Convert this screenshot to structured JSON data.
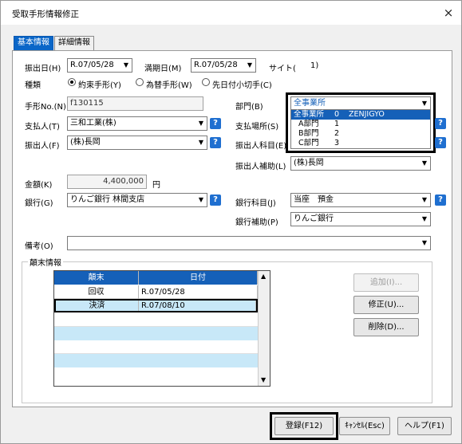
{
  "window": {
    "title": "受取手形情報修正",
    "close": "×"
  },
  "tabs": [
    {
      "label": "基本情報"
    },
    {
      "label": "詳細情報"
    }
  ],
  "form": {
    "issue_date": {
      "label": "振出日(H)",
      "value": "R.07/05/28"
    },
    "due_date": {
      "label": "満期日(M)",
      "value": "R.07/05/28"
    },
    "site": {
      "label": "サイト(",
      "value": "1)"
    },
    "type": {
      "label": "種類",
      "options": [
        "約束手形(Y)",
        "為替手形(W)",
        "先日付小切手(C)"
      ]
    },
    "bill_no": {
      "label": "手形No.(N)",
      "value": "f130115"
    },
    "department": {
      "label": "部門(B)",
      "value": "全事業所"
    },
    "payer": {
      "label": "支払人(T)",
      "value": "三和工業(株)"
    },
    "payment_place": {
      "label": "支払場所(S)"
    },
    "drawer": {
      "label": "振出人(F)",
      "value": "(株)長岡"
    },
    "drawer_account": {
      "label": "振出人科目(E)"
    },
    "drawer_sub": {
      "label": "振出人補助(L)",
      "value": "(株)長岡"
    },
    "amount": {
      "label": "金額(K)",
      "value": "4,400,000",
      "unit": "円"
    },
    "bank": {
      "label": "銀行(G)",
      "value": "りんご銀行 林間支店"
    },
    "bank_account": {
      "label": "銀行科目(J)",
      "value": "当座　預金"
    },
    "bank_sub": {
      "label": "銀行補助(P)",
      "value": "りんご銀行"
    },
    "memo": {
      "label": "備考(O)",
      "value": ""
    },
    "help_glyph": "?"
  },
  "department_dropdown": {
    "items": [
      {
        "name": "全事業所",
        "code": "0",
        "kana": "ZENJIGYO"
      },
      {
        "name": "A部門",
        "code": "1",
        "kana": ""
      },
      {
        "name": "B部門",
        "code": "2",
        "kana": ""
      },
      {
        "name": "C部門",
        "code": "3",
        "kana": ""
      }
    ]
  },
  "history": {
    "label": "顛末情報",
    "columns": [
      "顛末",
      "日付"
    ],
    "rows": [
      {
        "event": "回収",
        "date": "R.07/05/28"
      },
      {
        "event": "決済",
        "date": "R.07/08/10"
      }
    ],
    "buttons": {
      "add": "追加(I)...",
      "edit": "修正(U)...",
      "delete": "削除(D)..."
    }
  },
  "footer": {
    "register": "登録(F12)",
    "cancel": "ｷｬﾝｾﾙ(Esc)",
    "help": "ヘルプ(F1)"
  },
  "colors": {
    "accent": "#0a66c8",
    "selection": "#1560b8",
    "row_alt": "#c8e8f8",
    "help_icon": "#1f6fd0"
  },
  "icons": {
    "dropdown": "chevron-down-icon",
    "help": "question-icon",
    "close": "close-icon"
  }
}
